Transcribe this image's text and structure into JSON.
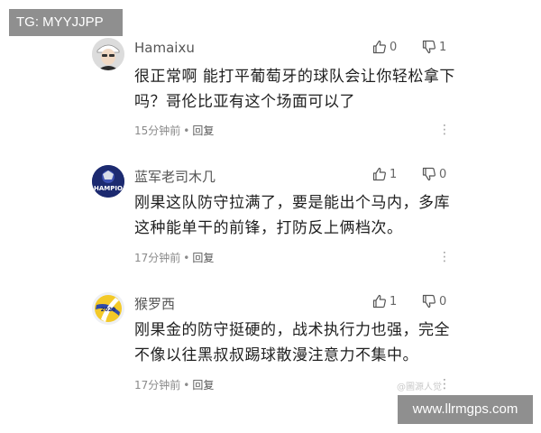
{
  "watermarks": {
    "top": "TG: MYYJJPP",
    "bottom": "www.llrmgps.com",
    "weibo": "@圖源人觉"
  },
  "colors": {
    "watermark_bg": "#8f8f8f",
    "text": "#1f1f1f",
    "meta": "#8a8a8a"
  },
  "comments": [
    {
      "username": "Hamaixu",
      "text": "很正常啊 能打平葡萄牙的球队会让你轻松拿下吗？哥伦比亚有这个场面可以了",
      "time": "15分钟前",
      "reply": "回复",
      "likes": "0",
      "dislikes": "1",
      "avatar_icon": "person-with-cap-avatar"
    },
    {
      "username": "蓝军老司木几",
      "text": "刚果这队防守拉满了，要是能出个马内，多库这种能单干的前锋，打防反上俩档次。",
      "time": "17分钟前",
      "reply": "回复",
      "likes": "1",
      "dislikes": "0",
      "avatar_icon": "champions-badge-avatar",
      "avatar_text": "HAMPIO"
    },
    {
      "username": "猴罗西",
      "text": "刚果金的防守挺硬的，战术执行力也强，完全不像以往黑叔叔踢球散漫注意力不集中。",
      "time": "17分钟前",
      "reply": "回复",
      "likes": "1",
      "dislikes": "0",
      "avatar_icon": "volleyball-avatar",
      "avatar_text": "2020"
    }
  ]
}
